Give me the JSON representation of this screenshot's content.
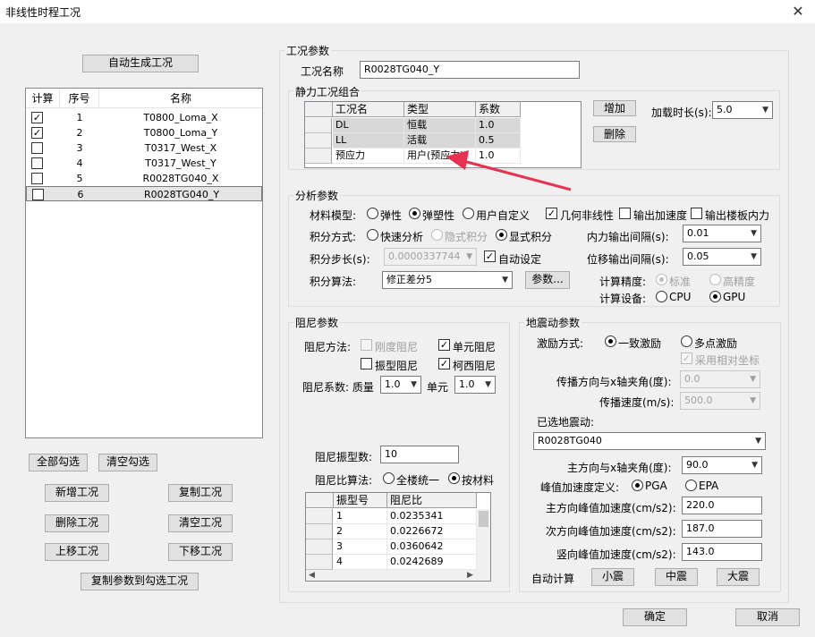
{
  "window": {
    "title": "非线性时程工况",
    "close": "✕"
  },
  "left": {
    "auto_gen_button": "自动生成工况",
    "headers": [
      "计算",
      "序号",
      "名称"
    ],
    "rows": [
      {
        "checked": true,
        "no": "1",
        "name": "T0800_Loma_X"
      },
      {
        "checked": true,
        "no": "2",
        "name": "T0800_Loma_Y"
      },
      {
        "checked": false,
        "no": "3",
        "name": "T0317_West_X"
      },
      {
        "checked": false,
        "no": "4",
        "name": "T0317_West_Y"
      },
      {
        "checked": false,
        "no": "5",
        "name": "R0028TG040_X"
      },
      {
        "checked": false,
        "no": "6",
        "name": "R0028TG040_Y"
      }
    ],
    "check_all": "全部勾选",
    "clear_check": "清空勾选",
    "add_case": "新增工况",
    "copy_case": "复制工况",
    "delete_case": "删除工况",
    "clear_case": "清空工况",
    "move_up": "上移工况",
    "move_down": "下移工况",
    "copy_params": "复制参数到勾选工况"
  },
  "case_params": {
    "group_title": "工况参数",
    "name_label": "工况名称",
    "name_value": "R0028TG040_Y",
    "static_group_title": "静力工况组合",
    "static_headers": [
      "工况名",
      "类型",
      "系数"
    ],
    "static_rows": [
      {
        "name": "DL",
        "type": "恒载",
        "factor": "1.0"
      },
      {
        "name": "LL",
        "type": "活载",
        "factor": "0.5"
      },
      {
        "name": "预应力",
        "type": "用户(预应力)",
        "factor": "1.0"
      }
    ],
    "add_btn": "增加",
    "del_btn": "删除",
    "load_time_label": "加载时长(s):",
    "load_time_value": "5.0"
  },
  "analysis": {
    "group_title": "分析参数",
    "material_label": "材料模型:",
    "mat_elastic": "弹性",
    "mat_elastoplastic": "弹塑性",
    "mat_user": "用户自定义",
    "geom_nonlinear": "几何非线性",
    "out_accel": "输出加速度",
    "out_floor_force": "输出楼板内力",
    "integ_label": "积分方式:",
    "integ_fast": "快速分析",
    "integ_implicit": "隐式积分",
    "integ_explicit": "显式积分",
    "force_out_label": "内力输出间隔(s):",
    "force_out_value": "0.01",
    "step_label": "积分步长(s):",
    "step_value": "0.0000337744",
    "auto_set": "自动设定",
    "disp_out_label": "位移输出间隔(s):",
    "disp_out_value": "0.05",
    "algo_label": "积分算法:",
    "algo_value": "修正差分5",
    "params_btn": "参数...",
    "precision_label": "计算精度:",
    "prec_standard": "标准",
    "prec_high": "高精度",
    "device_label": "计算设备:",
    "dev_cpu": "CPU",
    "dev_gpu": "GPU"
  },
  "damping": {
    "group_title": "阻尼参数",
    "method_label": "阻尼方法:",
    "stiff": "刚度阻尼",
    "elem": "单元阻尼",
    "mode": "振型阻尼",
    "rayleigh": "柯西阻尼",
    "coef_label": "阻尼系数: 质量",
    "mass_value": "1.0",
    "elem_label": "单元",
    "elem_value": "1.0",
    "modes_label": "阻尼振型数:",
    "modes_value": "10",
    "ratio_label": "阻尼比算法:",
    "ratio_uniform": "全楼统一",
    "ratio_material": "按材料",
    "table_headers": [
      "振型号",
      "阻尼比"
    ],
    "table_rows": [
      {
        "no": "1",
        "ratio": "0.0235341"
      },
      {
        "no": "2",
        "ratio": "0.0226672"
      },
      {
        "no": "3",
        "ratio": "0.0360642"
      },
      {
        "no": "4",
        "ratio": "0.0242689"
      }
    ]
  },
  "ground": {
    "group_title": "地震动参数",
    "excite_label": "激励方式:",
    "uniform": "一致激励",
    "multi": "多点激励",
    "relative_coord": "采用相对坐标",
    "dir_angle_label": "传播方向与x轴夹角(度):",
    "dir_angle_value": "0.0",
    "speed_label": "传播速度(m/s):",
    "speed_value": "500.0",
    "selected_label": "已选地震动:",
    "selected_value": "R0028TG040",
    "main_angle_label": "主方向与x轴夹角(度):",
    "main_angle_value": "90.0",
    "pga_def_label": "峰值加速度定义:",
    "pga": "PGA",
    "epa": "EPA",
    "main_pga_label": "主方向峰值加速度(cm/s2):",
    "main_pga_value": "220.0",
    "sec_pga_label": "次方向峰值加速度(cm/s2):",
    "sec_pga_value": "187.0",
    "vert_pga_label": "竖向峰值加速度(cm/s2):",
    "vert_pga_value": "143.0",
    "auto_calc_label": "自动计算",
    "small": "小震",
    "medium": "中震",
    "large": "大震"
  },
  "footer": {
    "ok": "确定",
    "cancel": "取消"
  },
  "colors": {
    "annotation_arrow": "#e8324f"
  }
}
